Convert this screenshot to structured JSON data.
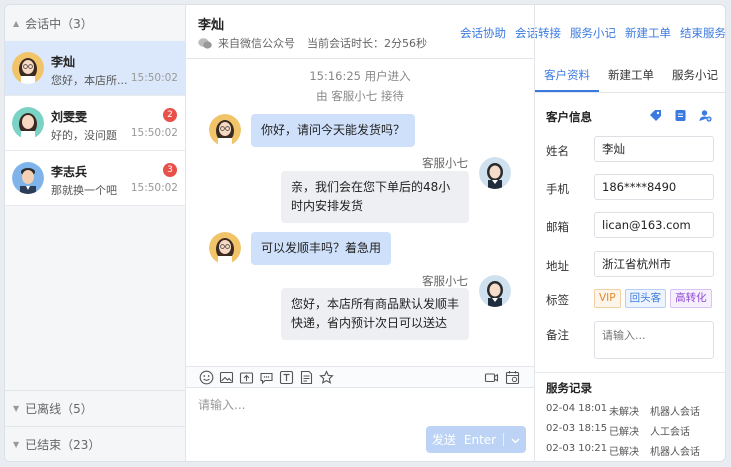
{
  "sidebar": {
    "active_group": {
      "label": "会话中（3）"
    },
    "conversations": [
      {
        "name": "李灿",
        "snippet": "您好，本店所...",
        "time": "15:50:02",
        "badge": ""
      },
      {
        "name": "刘雯雯",
        "snippet": "好的，没问题",
        "time": "15:50:02",
        "badge": "2"
      },
      {
        "name": "李志兵",
        "snippet": "那就换一个吧",
        "time": "15:50:02",
        "badge": "3"
      }
    ],
    "offline_group": {
      "label": "已离线（5）"
    },
    "ended_group": {
      "label": "已结束（23）"
    }
  },
  "chat": {
    "title": "李灿",
    "source": "来自微信公众号",
    "duration": "当前会话时长：2分56秒",
    "actions": [
      "会话协助",
      "会话转接",
      "服务小记",
      "新建工单",
      "结束服务"
    ],
    "system_lines": [
      "15:16:25 用户进入",
      "由 客服小七 接待"
    ],
    "messages": [
      {
        "from": "user",
        "text": "你好，请问今天能发货吗？"
      },
      {
        "from": "agent",
        "name": "客服小七",
        "line1": "亲，我们会在您下单后的48小",
        "line2": "时内安排发货"
      },
      {
        "from": "user",
        "text": "可以发顺丰吗？着急用"
      },
      {
        "from": "agent",
        "name": "客服小七",
        "line1": "您好，本店所有商品默认发顺丰",
        "line2": "快递，省内预计次日可以送达"
      }
    ],
    "input_placeholder": "请输入...",
    "send_label": "发送",
    "send_hint": "Enter"
  },
  "panel": {
    "tabs": [
      "客户资料",
      "新建工单",
      "服务小记"
    ],
    "section_title": "客户信息",
    "fields": [
      {
        "label": "姓名",
        "value": "李灿"
      },
      {
        "label": "手机",
        "value": "186****8490"
      },
      {
        "label": "邮箱",
        "value": "lican@163.com"
      },
      {
        "label": "地址",
        "value": "浙江省杭州市"
      }
    ],
    "tags_label": "标签",
    "tags": [
      "VIP",
      "回头客",
      "高转化"
    ],
    "note_label": "备注",
    "note_placeholder": "请输入...",
    "records_title": "服务记录",
    "records": [
      {
        "time": "02-04 18:01",
        "status": "未解决",
        "type": "机器人会话"
      },
      {
        "time": "02-03 18:15",
        "status": "已解决",
        "type": "人工会话"
      },
      {
        "time": "02-03 10:21",
        "status": "已解决",
        "type": "机器人会话"
      }
    ]
  },
  "colors": {
    "accent": "#3a7ae0",
    "user_bubble": "#cfe0fb",
    "agent_bubble": "#eeeff2",
    "badge": "#e8504a",
    "active_row": "#dbe8fb"
  },
  "icons": [
    "emoji-icon",
    "image-icon",
    "upload-icon",
    "chat-bubble-icon",
    "text-icon",
    "note-icon",
    "star-icon",
    "video-icon",
    "calendar-icon",
    "tag-icon",
    "doc-icon",
    "user-add-icon",
    "wechat-icon"
  ]
}
